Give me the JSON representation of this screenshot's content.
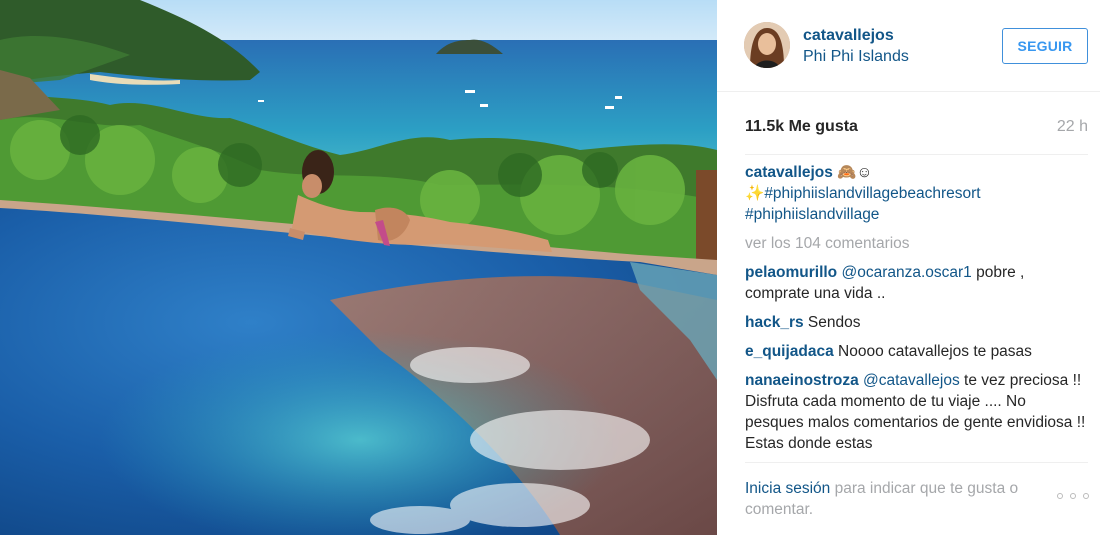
{
  "post": {
    "username": "catavallejos",
    "location": "Phi Phi Islands",
    "follow_label": "SEGUIR",
    "likes": "11.5k Me gusta",
    "time": "22 h"
  },
  "caption": {
    "username": "catavallejos",
    "emoji": "🙈☺",
    "sparkle": "✨",
    "hashtag1": "#phiphiislandvillagebeachresort",
    "hashtag2": "#phiphiislandvillage"
  },
  "view_all_comments": "ver los 104 comentarios",
  "comments": [
    {
      "user": "pelaomurillo",
      "mention": "@ocaranza.oscar1",
      "text": " pobre , comprate una vida .."
    },
    {
      "user": "hack_rs",
      "mention": "",
      "text": " Sendos"
    },
    {
      "user": "e_quijadaca",
      "mention": "",
      "text": " Noooo catavallejos te pasas"
    },
    {
      "user": "nanaeinostroza",
      "mention": "@catavallejos",
      "text": " te vez preciosa !! Disfruta cada momento de tu viaje .... No pesques malos comentarios de gente envidiosa !! Estas donde estas"
    }
  ],
  "footer": {
    "login_link": "Inicia sesión",
    "text": " para indicar que te gusta o comentar."
  },
  "icons": {
    "more": "more-options-icon"
  }
}
